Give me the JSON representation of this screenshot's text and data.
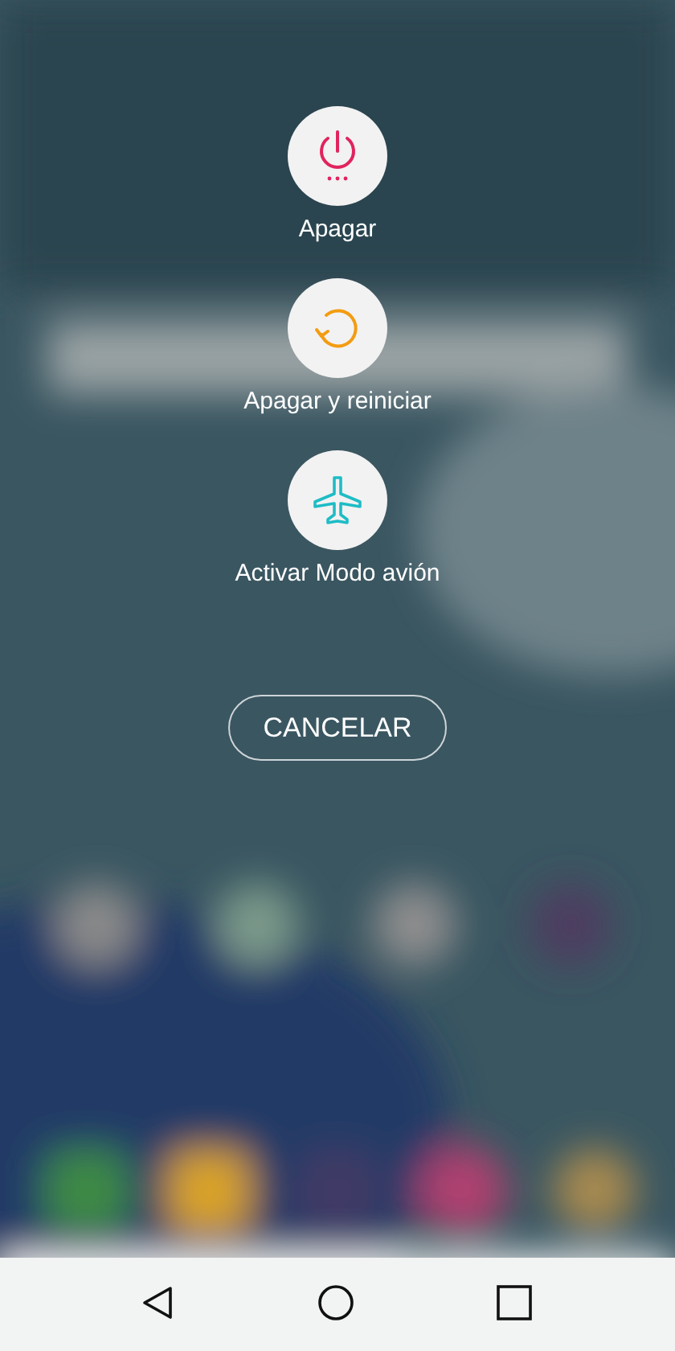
{
  "power_menu": {
    "options": [
      {
        "kind": "power",
        "label": "Apagar"
      },
      {
        "kind": "restart",
        "label": "Apagar y reiniciar"
      },
      {
        "kind": "airplane",
        "label": "Activar Modo avión"
      }
    ],
    "cancel_button": "CANCELAR"
  },
  "nav_bar": {
    "buttons": [
      {
        "kind": "back"
      },
      {
        "kind": "home"
      },
      {
        "kind": "recents"
      }
    ]
  }
}
